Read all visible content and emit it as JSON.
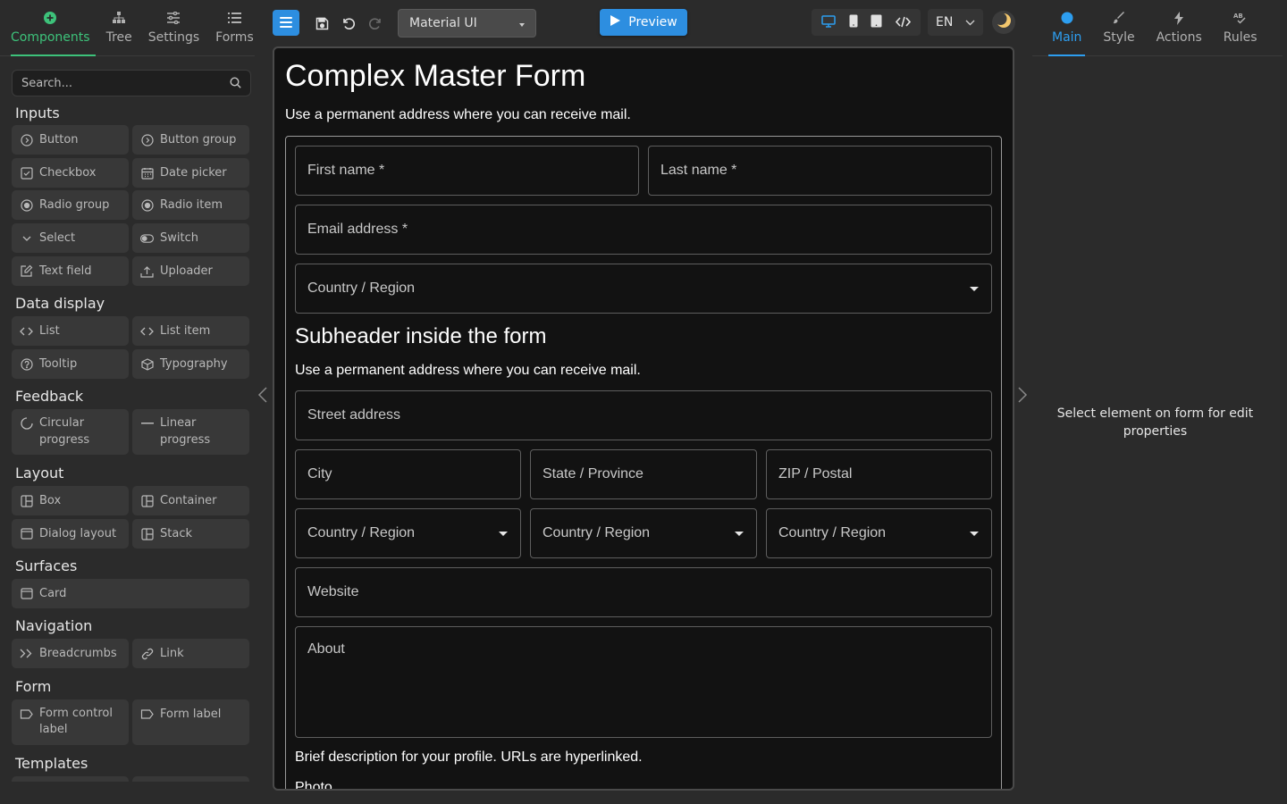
{
  "left_panel": {
    "tabs": [
      {
        "label": "Components",
        "icon": "plus-circle-icon",
        "active": true
      },
      {
        "label": "Tree",
        "icon": "sitemap-icon",
        "active": false
      },
      {
        "label": "Settings",
        "icon": "sliders-icon",
        "active": false
      },
      {
        "label": "Forms",
        "icon": "list-icon",
        "active": false
      }
    ],
    "search_placeholder": "Search...",
    "categories": {
      "inputs": "Inputs",
      "data_display": "Data display",
      "feedback": "Feedback",
      "layout": "Layout",
      "surfaces": "Surfaces",
      "navigation": "Navigation",
      "form": "Form",
      "templates": "Templates"
    },
    "components": {
      "button": "Button",
      "button_group": "Button group",
      "checkbox": "Checkbox",
      "date_picker": "Date picker",
      "radio_group": "Radio group",
      "radio_item": "Radio item",
      "select": "Select",
      "switch": "Switch",
      "text_field": "Text field",
      "uploader": "Uploader",
      "list": "List",
      "list_item": "List item",
      "tooltip": "Tooltip",
      "typography": "Typography",
      "circular_progress": "Circular progress",
      "linear_progress": "Linear progress",
      "box": "Box",
      "container": "Container",
      "dialog_layout": "Dialog layout",
      "stack": "Stack",
      "card": "Card",
      "breadcrumbs": "Breadcrumbs",
      "link": "Link",
      "form_control_label": "Form control label",
      "form_label": "Form label"
    }
  },
  "toolbar": {
    "theme_select_value": "Material UI",
    "preview_label": "Preview",
    "language": "EN"
  },
  "form": {
    "title": "Complex Master Form",
    "description": "Use a permanent address where you can receive mail.",
    "first_name": "First name *",
    "last_name": "Last name *",
    "email": "Email address *",
    "country": "Country / Region",
    "subheader": "Subheader inside the form",
    "subheader_desc": "Use a permanent address where you can receive mail.",
    "street": "Street address",
    "city": "City",
    "state": "State / Province",
    "zip": "ZIP / Postal",
    "country_1": "Country / Region",
    "country_2": "Country / Region",
    "country_3": "Country / Region",
    "website": "Website",
    "about": "About",
    "about_helper": "Brief description for your profile. URLs are hyperlinked.",
    "photo": "Photo"
  },
  "right_panel": {
    "tabs": [
      {
        "label": "Main",
        "icon": "circle-icon",
        "active": true
      },
      {
        "label": "Style",
        "icon": "brush-icon",
        "active": false
      },
      {
        "label": "Actions",
        "icon": "bolt-icon",
        "active": false
      },
      {
        "label": "Rules",
        "icon": "spellcheck-icon",
        "active": false
      }
    ],
    "hint": "Select element on form for edit properties"
  },
  "colors": {
    "accent_green": "#3dc27a",
    "accent_blue": "#2d8ee0",
    "panel_bg": "#2b2b2b",
    "canvas_bg": "#121212"
  }
}
